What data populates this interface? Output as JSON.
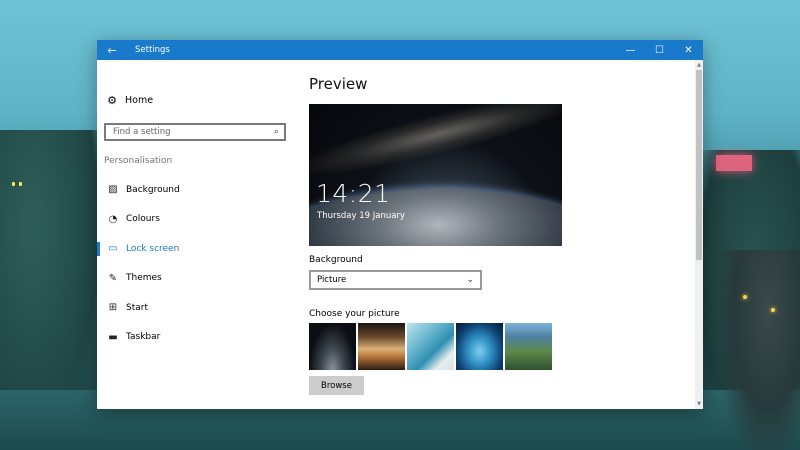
{
  "window": {
    "title": "Settings",
    "back_icon": "arrow-left-icon",
    "minimize_glyph": "—",
    "maximize_glyph": "☐",
    "close_glyph": "✕"
  },
  "sidebar": {
    "home_label": "Home",
    "search_placeholder": "Find a setting",
    "section_label": "Personalisation",
    "items": [
      {
        "label": "Background",
        "icon": "picture-icon"
      },
      {
        "label": "Colours",
        "icon": "palette-icon"
      },
      {
        "label": "Lock screen",
        "icon": "lock-screen-icon",
        "active": true
      },
      {
        "label": "Themes",
        "icon": "brush-icon"
      },
      {
        "label": "Start",
        "icon": "start-grid-icon"
      },
      {
        "label": "Taskbar",
        "icon": "taskbar-icon"
      }
    ]
  },
  "main": {
    "heading": "Preview",
    "preview_time": "14:21",
    "preview_date": "Thursday 19 January",
    "background_label": "Background",
    "background_value": "Picture",
    "choose_label": "Choose your picture",
    "browse_label": "Browse"
  }
}
